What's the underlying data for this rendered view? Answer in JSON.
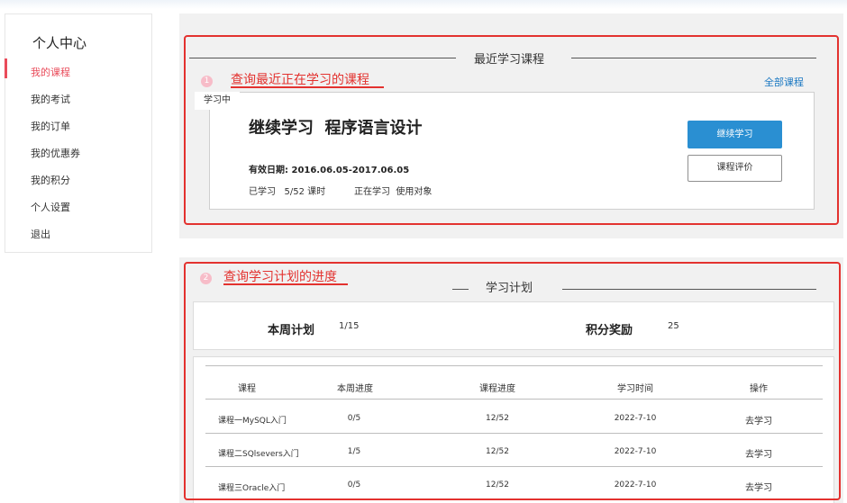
{
  "sidebar": {
    "title": "个人中心",
    "items": [
      {
        "label": "我的课程",
        "active": true
      },
      {
        "label": "我的考试"
      },
      {
        "label": "我的订单"
      },
      {
        "label": "我的优惠券"
      },
      {
        "label": "我的积分"
      },
      {
        "label": "个人设置"
      },
      {
        "label": "退出"
      }
    ]
  },
  "recent": {
    "section_title": "最近学习课程",
    "badge": "1",
    "annotation": "查询最近正在学习的课程",
    "all_courses_link": "全部课程",
    "status_tag": "学习中",
    "course_name": "继续学习  程序语言设计",
    "valid_period": "有效日期: 2016.06.05-2017.06.05",
    "progress_text": "已学习   5/52 课时          正在学习  使用对象",
    "continue_button": "继续学习",
    "rate_button": "课程评价"
  },
  "plan": {
    "section_title": "学习计划",
    "badge": "2",
    "annotation": "查询学习计划的进度",
    "weekly_label": "本周计划",
    "weekly_value": "1/15",
    "points_label": "积分奖励",
    "points_value": "25",
    "columns": [
      "课程",
      "本周进度",
      "课程进度",
      "学习时间",
      "操作"
    ],
    "rows": [
      {
        "course": "课程一MySQL入门",
        "week": "0/5",
        "progress": "12/52",
        "time": "2022-7-10",
        "action": "去学习"
      },
      {
        "course": "课程二SQlsevers入门",
        "week": "1/5",
        "progress": "12/52",
        "time": "2022-7-10",
        "action": "去学习"
      },
      {
        "course": "课程三Oracle入门",
        "week": "0/5",
        "progress": "12/52",
        "time": "2022-7-10",
        "action": "去学习"
      }
    ]
  },
  "colors": {
    "accent_red": "#e3322f",
    "active_pink": "#e94b5a",
    "link_blue": "#1a78c2",
    "button_blue": "#2a8fd2"
  }
}
